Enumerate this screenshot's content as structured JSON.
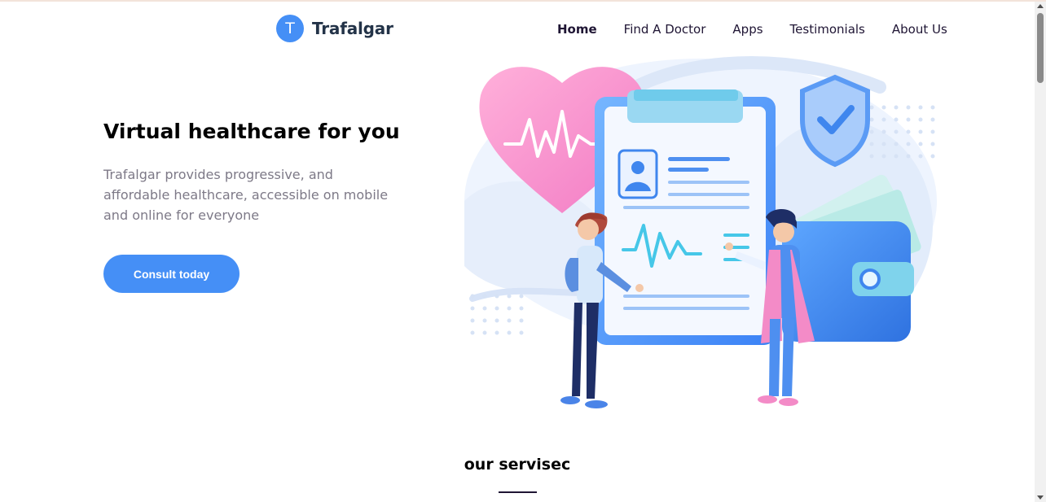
{
  "brand": {
    "initial": "T",
    "name": "Trafalgar"
  },
  "nav": [
    "Home",
    "Find A Doctor",
    "Apps",
    "Testimonials",
    "About Us"
  ],
  "hero": {
    "title": "Virtual healthcare for you",
    "description": "Trafalgar provides progressive, and affordable healthcare, accessible on mobile and online for everyone",
    "cta": "Consult today"
  },
  "services": {
    "title": "our servisec"
  },
  "colors": {
    "primary": "#458FF6",
    "heading": "#000000",
    "body_text": "#7D7987",
    "nav_text": "#1F1534",
    "pink": "#F38BC7"
  },
  "icons": [
    "heart-pulse-icon",
    "shield-check-icon",
    "clipboard-icon",
    "wallet-icon",
    "user-avatar-icon"
  ]
}
